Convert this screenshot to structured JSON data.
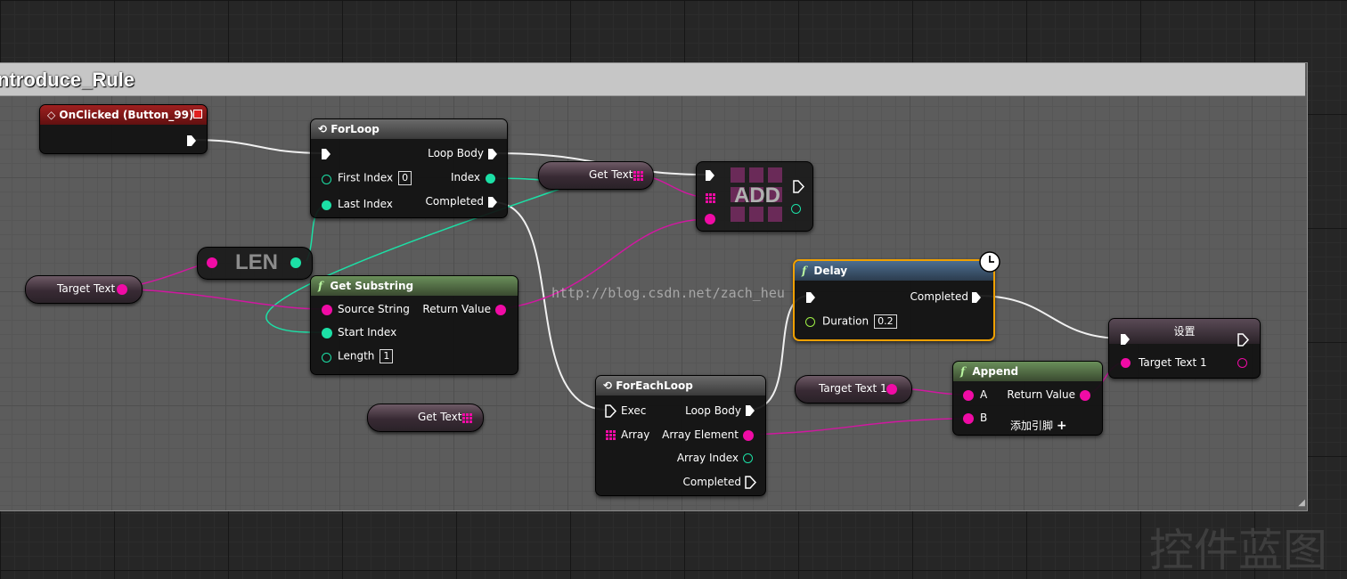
{
  "comment": {
    "title": "ntroduce_Rule"
  },
  "colors": {
    "exec": "#ffffff",
    "string": "#f00ba5",
    "int": "#1ce0a6",
    "float": "#9ff046",
    "delay_outline": "#f0a000"
  },
  "nodes": {
    "on_clicked": {
      "title": "OnClicked (Button_99)"
    },
    "for_loop": {
      "title": "ForLoop",
      "first_index_label": "First Index",
      "first_index_value": "0",
      "last_index_label": "Last Index",
      "loop_body_label": "Loop Body",
      "index_label": "Index",
      "completed_label": "Completed"
    },
    "get_text_top": {
      "label": "Get Text"
    },
    "add": {
      "label": "ADD"
    },
    "len": {
      "label": "LEN"
    },
    "target_text_var": {
      "label": "Target Text"
    },
    "get_substring": {
      "title": "Get Substring",
      "source_label": "Source String",
      "start_label": "Start Index",
      "length_label": "Length",
      "length_value": "1",
      "return_label": "Return Value"
    },
    "delay": {
      "title": "Delay",
      "completed_label": "Completed",
      "duration_label": "Duration",
      "duration_value": "0.2"
    },
    "set_node": {
      "title": "设置",
      "target_label": "Target Text 1"
    },
    "get_text_bottom": {
      "label": "Get Text"
    },
    "foreach": {
      "title": "ForEachLoop",
      "exec_label": "Exec",
      "array_label": "Array",
      "loop_body_label": "Loop Body",
      "array_element_label": "Array Element",
      "array_index_label": "Array Index",
      "completed_label": "Completed"
    },
    "target_text1_var": {
      "label": "Target Text 1"
    },
    "append": {
      "title": "Append",
      "a_label": "A",
      "b_label": "B",
      "return_label": "Return Value",
      "add_pin_label": "添加引脚"
    }
  },
  "watermark": "http://blog.csdn.net/zach_heu",
  "corner_text": "控件蓝图"
}
